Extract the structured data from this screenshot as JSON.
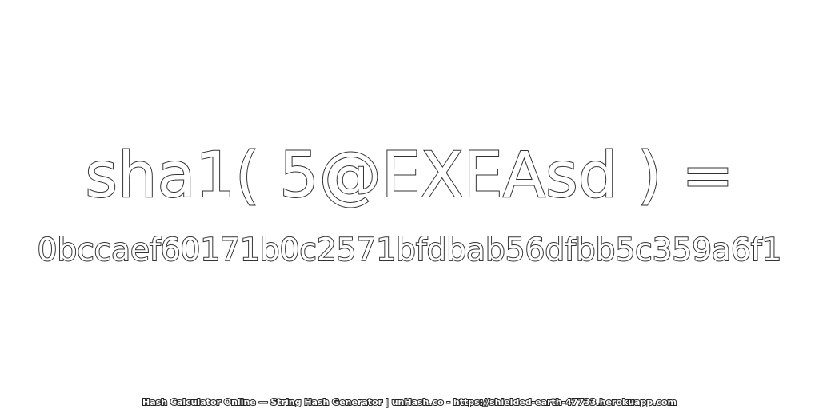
{
  "expression": "sha1( 5@EXEAsd ) =",
  "hash_value": "0bccaef60171b0c2571bfdbab56dfbb5c359a6f1",
  "footer": "Hash Calculator Online — String Hash Generator | unHash.co - https://shielded-earth-47733.herokuapp.com"
}
